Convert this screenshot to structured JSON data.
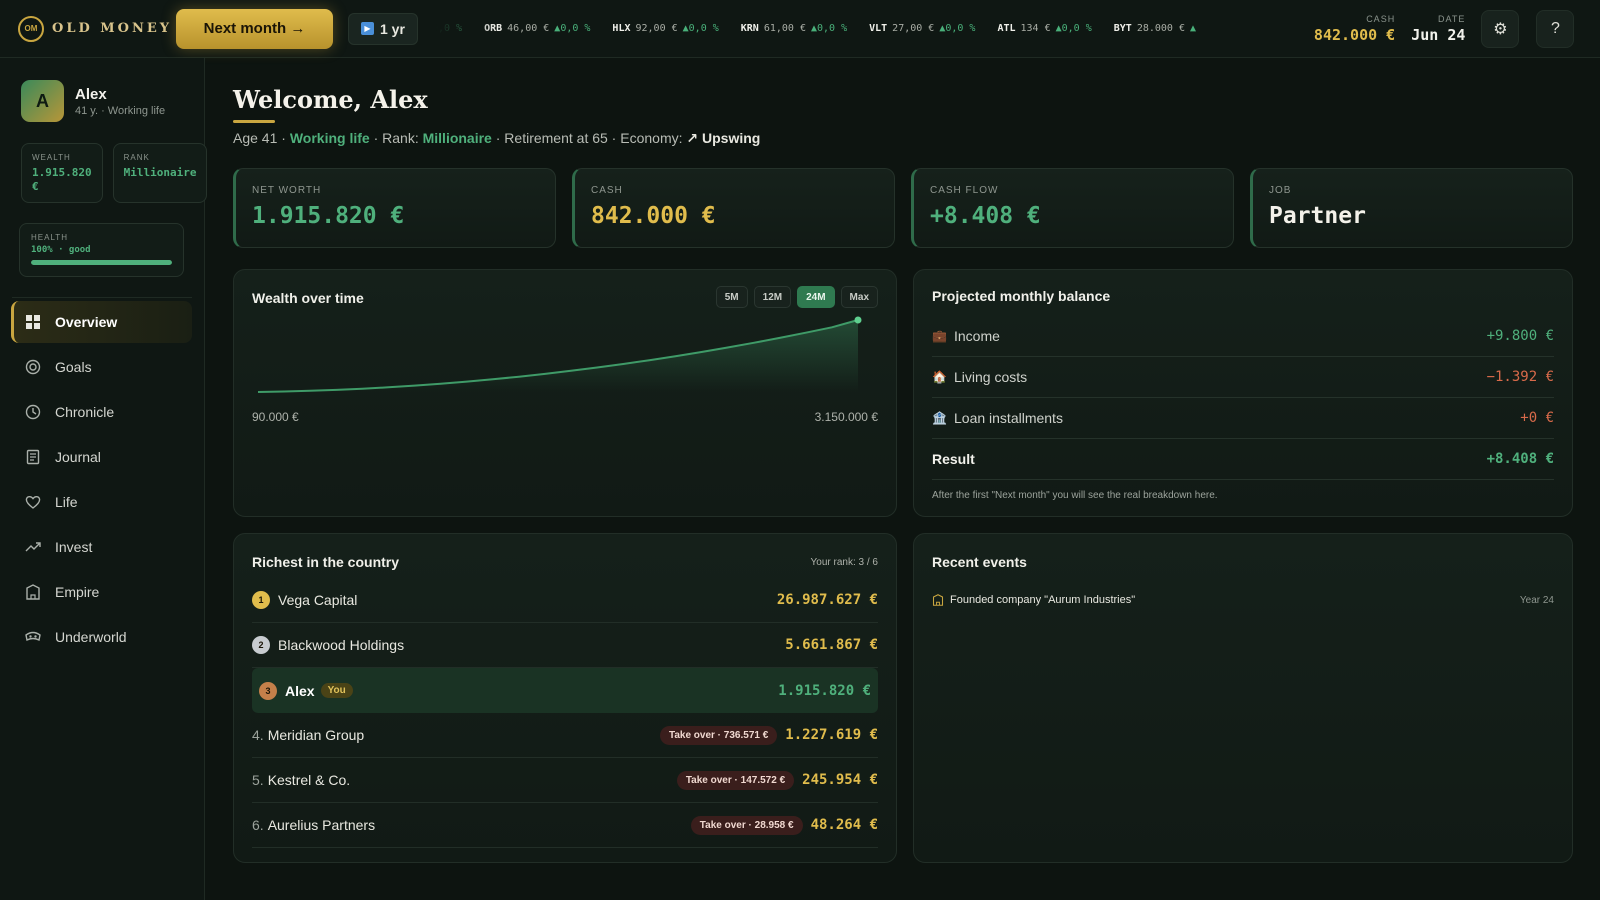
{
  "brand": {
    "logo_mark": "OM",
    "name": "OLD MONEY"
  },
  "toolbar": {
    "next_label": "Next month →",
    "speed_label": "1 yr",
    "cash_label": "CASH",
    "cash_value": "842.000 €",
    "date_label": "DATE",
    "date_value": "Jun 24",
    "settings_icon": "gear-icon",
    "help_label": "?"
  },
  "ticker": [
    {
      "symbol": "",
      "price": "€",
      "change": "▲0,0 %"
    },
    {
      "symbol": "ORB",
      "price": "46,00 €",
      "change": "▲0,0 %"
    },
    {
      "symbol": "HLX",
      "price": "92,00 €",
      "change": "▲0,0 %"
    },
    {
      "symbol": "KRN",
      "price": "61,00 €",
      "change": "▲0,0 %"
    },
    {
      "symbol": "VLT",
      "price": "27,00 €",
      "change": "▲0,0 %"
    },
    {
      "symbol": "ATL",
      "price": "134 €",
      "change": "▲0,0 %"
    },
    {
      "symbol": "BYT",
      "price": "28.000 €",
      "change": "▲"
    }
  ],
  "profile": {
    "avatar_letter": "A",
    "name": "Alex",
    "subtitle": "41 y. · Working life",
    "wealth_label": "WEALTH",
    "wealth_value": "1.915.820 €",
    "rank_label": "RANK",
    "rank_value": "Millionaire",
    "health_label": "HEALTH",
    "health_value": "100% · good",
    "health_pct": 100
  },
  "nav": [
    {
      "label": "Overview",
      "icon": "grid-icon",
      "active": true
    },
    {
      "label": "Goals",
      "icon": "target-icon"
    },
    {
      "label": "Chronicle",
      "icon": "clock-icon"
    },
    {
      "label": "Journal",
      "icon": "journal-icon"
    },
    {
      "label": "Life",
      "icon": "heart-icon"
    },
    {
      "label": "Invest",
      "icon": "trend-icon"
    },
    {
      "label": "Empire",
      "icon": "building-icon"
    },
    {
      "label": "Underworld",
      "icon": "mask-icon"
    }
  ],
  "header": {
    "title": "Welcome, Alex",
    "age": "Age 41",
    "phase": "Working life",
    "rank_prefix": "Rank:",
    "rank": "Millionaire",
    "retirement": "Retirement at 65",
    "economy_prefix": "Economy:",
    "economy": "Upswing"
  },
  "stats": [
    {
      "label": "NET WORTH",
      "value": "1.915.820 €",
      "color": "#4fb07c"
    },
    {
      "label": "CASH",
      "value": "842.000 €",
      "color": "#e0bc4c"
    },
    {
      "label": "CASH FLOW",
      "value": "+8.408 €",
      "color": "#4fb07c"
    },
    {
      "label": "JOB",
      "value": "Partner",
      "color": "#f4f2ea"
    }
  ],
  "wealth_chart": {
    "title": "Wealth over time",
    "ranges": [
      "5M",
      "12M",
      "24M",
      "Max"
    ],
    "active_range": "24M",
    "min_label": "90.000 €",
    "max_label": "3.150.000 €"
  },
  "chart_data": {
    "type": "area",
    "title": "Wealth over time",
    "x": [
      0,
      1,
      2,
      3,
      4,
      5,
      6,
      7,
      8,
      9,
      10,
      11,
      12,
      13,
      14,
      15,
      16,
      17,
      18,
      19,
      20,
      21,
      22,
      23
    ],
    "values": [
      90000,
      110000,
      140000,
      180000,
      230000,
      290000,
      360000,
      440000,
      530000,
      630000,
      740000,
      860000,
      990000,
      1130000,
      1280000,
      1440000,
      1610000,
      1790000,
      1980000,
      2180000,
      2390000,
      2610000,
      2840000,
      3150000
    ],
    "ylim": [
      90000,
      3150000
    ],
    "color": "#3f9b68"
  },
  "balance": {
    "title": "Projected monthly balance",
    "rows": [
      {
        "icon": "briefcase-icon",
        "glyph": "💼",
        "label": "Income",
        "value": "+9.800 €",
        "color": "#4fb07c"
      },
      {
        "icon": "house-icon",
        "glyph": "🏠",
        "label": "Living costs",
        "value": "−1.392 €",
        "color": "#d86a4a"
      },
      {
        "icon": "bank-icon",
        "glyph": "🏦",
        "label": "Loan installments",
        "value": "+0 €",
        "color": "#d86a4a"
      }
    ],
    "result_label": "Result",
    "result_value": "+8.408 €",
    "note": "After the first \"Next month\" you will see the real breakdown here."
  },
  "richest": {
    "title": "Richest in the country",
    "your_rank": "Your rank: 3 / 6",
    "rows": [
      {
        "rank": "1",
        "name": "Vega Capital",
        "amount": "26.987.627 €",
        "medal": "#e0bc4c"
      },
      {
        "rank": "2",
        "name": "Blackwood Holdings",
        "amount": "5.661.867 €",
        "medal": "#c8ccd0"
      },
      {
        "rank": "3",
        "name": "Alex",
        "amount": "1.915.820 €",
        "medal": "#c4804a",
        "you": "You"
      },
      {
        "rank": "4.",
        "name": "Meridian Group",
        "amount": "1.227.619 €",
        "takeover": "Take over · 736.571 €"
      },
      {
        "rank": "5.",
        "name": "Kestrel & Co.",
        "amount": "245.954 €",
        "takeover": "Take over · 147.572 €"
      },
      {
        "rank": "6.",
        "name": "Aurelius Partners",
        "amount": "48.264 €",
        "takeover": "Take over · 28.958 €"
      }
    ]
  },
  "events": {
    "title": "Recent events",
    "items": [
      {
        "icon": "building-icon",
        "text": "Founded company \"Aurum Industries\"",
        "time": "Year 24"
      }
    ]
  }
}
